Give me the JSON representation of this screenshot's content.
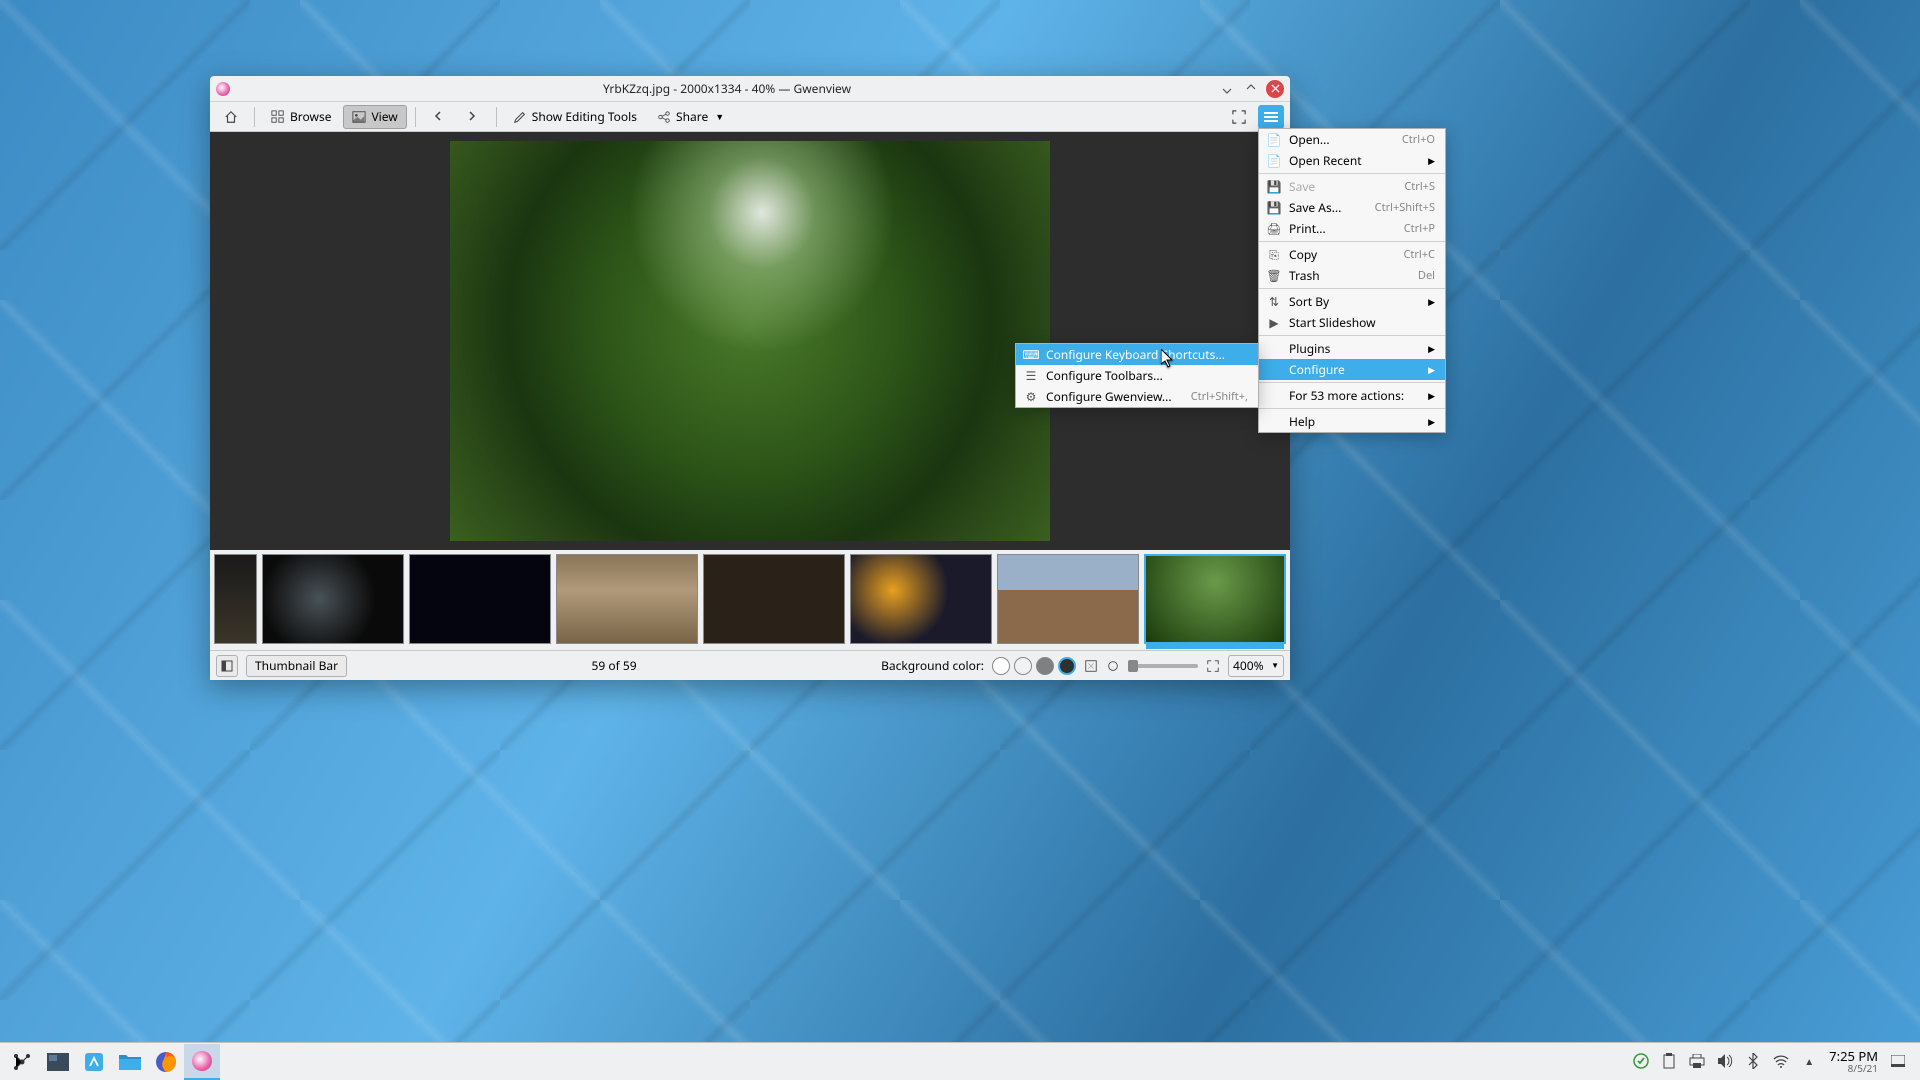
{
  "window": {
    "title": "YrbKZzq.jpg - 2000x1334 - 40% — Gwenview"
  },
  "toolbar": {
    "browse": "Browse",
    "view": "View",
    "show_editing": "Show Editing Tools",
    "share": "Share"
  },
  "statusbar": {
    "thumbnail_bar": "Thumbnail Bar",
    "counter": "59 of 59",
    "bg_label": "Background color:",
    "zoom": "400%"
  },
  "main_menu": {
    "items": [
      {
        "label": "Open...",
        "shortcut": "Ctrl+O",
        "icon": "document-open"
      },
      {
        "label": "Open Recent",
        "submenu": true,
        "icon": "document-open"
      },
      {
        "label": "Save",
        "shortcut": "Ctrl+S",
        "disabled": true,
        "icon": "document-save"
      },
      {
        "label": "Save As...",
        "shortcut": "Ctrl+Shift+S",
        "icon": "document-save"
      },
      {
        "label": "Print...",
        "shortcut": "Ctrl+P",
        "icon": "printer"
      },
      {
        "label": "Copy",
        "shortcut": "Ctrl+C",
        "icon": "copy"
      },
      {
        "label": "Trash",
        "shortcut": "Del",
        "icon": "trash"
      },
      {
        "label": "Sort By",
        "submenu": true,
        "icon": "sort"
      },
      {
        "label": "Start Slideshow",
        "icon": "play"
      },
      {
        "label": "Plugins",
        "submenu": true
      },
      {
        "label": "Configure",
        "submenu": true,
        "highlight": true
      },
      {
        "label": "For 53 more actions:",
        "submenu": true
      },
      {
        "label": "Help",
        "submenu": true
      }
    ]
  },
  "sub_menu": {
    "items": [
      {
        "label": "Configure Keyboard Shortcuts...",
        "highlight": true,
        "icon": "keyboard"
      },
      {
        "label": "Configure Toolbars...",
        "icon": "sliders"
      },
      {
        "label": "Configure Gwenview...",
        "shortcut": "Ctrl+Shift+,",
        "icon": "gear"
      }
    ]
  },
  "taskbar": {
    "time": "7:25 PM",
    "date": "8/5/21"
  },
  "bg_swatches": [
    "#ffffff",
    "#f7f7f7",
    "#808080",
    "#303030"
  ]
}
